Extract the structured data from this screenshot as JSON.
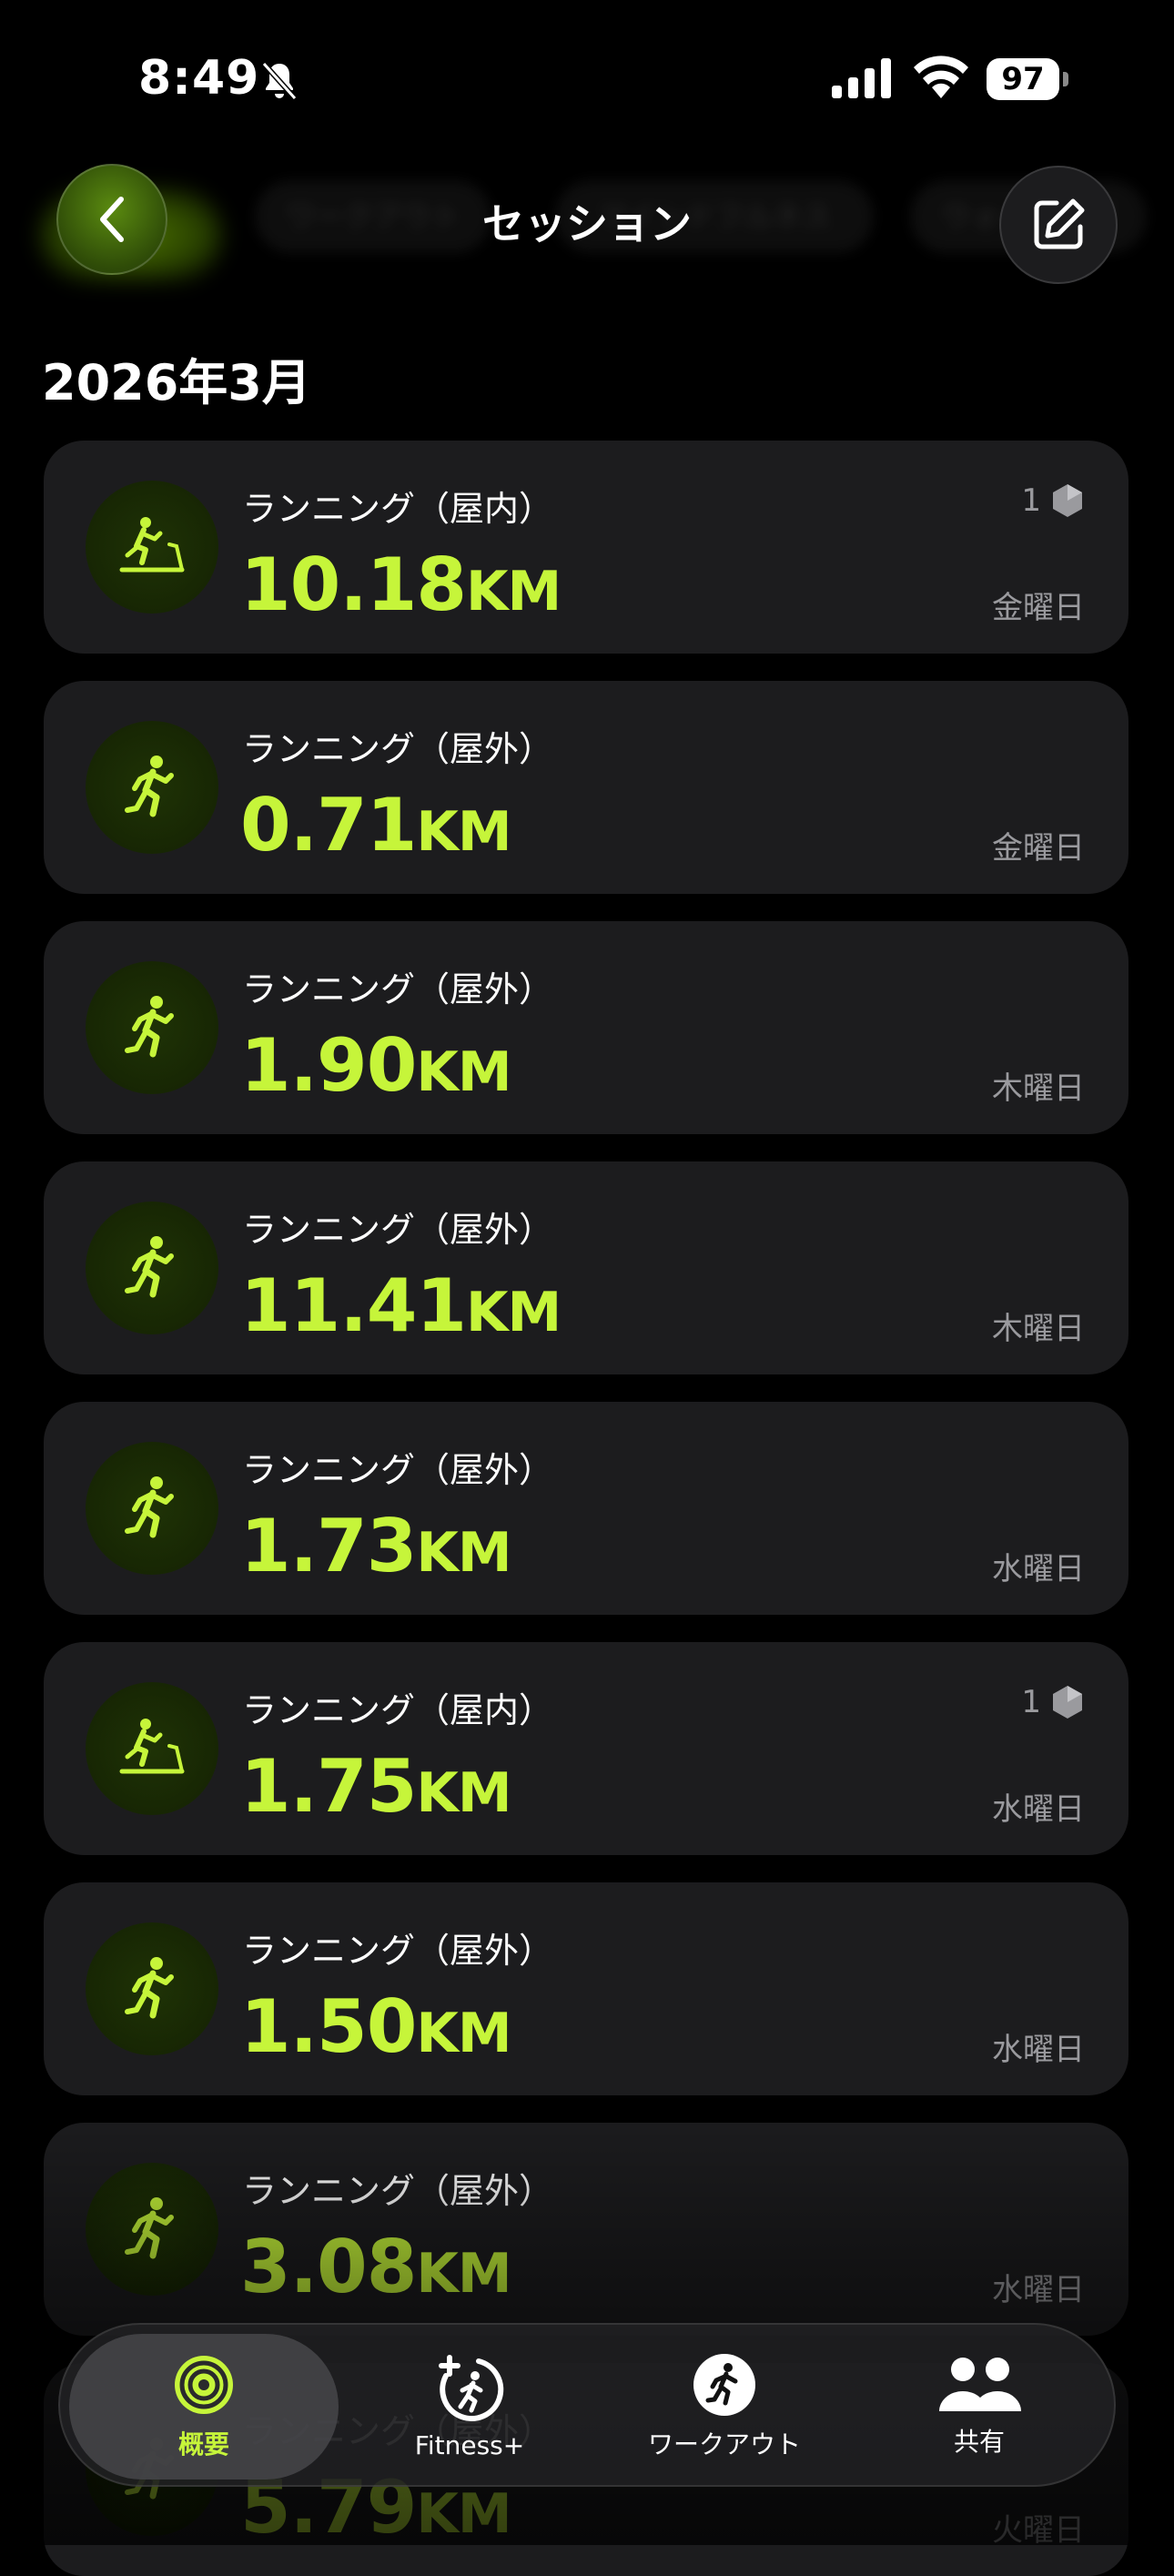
{
  "status_bar": {
    "time": "8:49",
    "battery": "97"
  },
  "header": {
    "title": "セッション",
    "bg_tabs": [
      "ワークアウト",
      "マインドフルネス",
      "ウォーキング"
    ]
  },
  "section": {
    "title": "2026年3月"
  },
  "sessions": [
    {
      "type": "indoor",
      "name": "ランニング（屋内）",
      "distance": "10.18",
      "unit": "KM",
      "day": "金曜日",
      "badge": "1"
    },
    {
      "type": "outdoor",
      "name": "ランニング（屋外）",
      "distance": "0.71",
      "unit": "KM",
      "day": "金曜日",
      "badge": ""
    },
    {
      "type": "outdoor",
      "name": "ランニング（屋外）",
      "distance": "1.90",
      "unit": "KM",
      "day": "木曜日",
      "badge": ""
    },
    {
      "type": "outdoor",
      "name": "ランニング（屋外）",
      "distance": "11.41",
      "unit": "KM",
      "day": "木曜日",
      "badge": ""
    },
    {
      "type": "outdoor",
      "name": "ランニング（屋外）",
      "distance": "1.73",
      "unit": "KM",
      "day": "水曜日",
      "badge": ""
    },
    {
      "type": "indoor",
      "name": "ランニング（屋内）",
      "distance": "1.75",
      "unit": "KM",
      "day": "水曜日",
      "badge": "1"
    },
    {
      "type": "outdoor",
      "name": "ランニング（屋外）",
      "distance": "1.50",
      "unit": "KM",
      "day": "水曜日",
      "badge": ""
    },
    {
      "type": "outdoor",
      "name": "ランニング（屋外）",
      "distance": "3.08",
      "unit": "KM",
      "day": "水曜日",
      "badge": ""
    },
    {
      "type": "outdoor",
      "name": "ランニング（屋外）",
      "distance": "5.79",
      "unit": "KM",
      "day": "火曜日",
      "badge": ""
    }
  ],
  "tabbar": {
    "tabs": [
      {
        "label": "概要",
        "icon": "summary-rings-icon",
        "active": true
      },
      {
        "label": "Fitness+",
        "icon": "fitness-plus-icon",
        "active": false
      },
      {
        "label": "ワークアウト",
        "icon": "workout-icon",
        "active": false
      },
      {
        "label": "共有",
        "icon": "sharing-icon",
        "active": false
      }
    ]
  },
  "colors": {
    "accent": "#c6f53a",
    "card": "#1c1c1e",
    "muted": "#9a9a9e"
  }
}
